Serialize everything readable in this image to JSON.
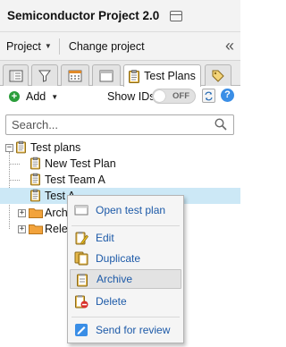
{
  "window": {
    "title": "Semiconductor Project 2.0"
  },
  "project_bar": {
    "project_label": "Project",
    "change_project_label": "Change project",
    "collapse_glyph": "«"
  },
  "tabs": [
    {
      "icon": "document-list-icon",
      "label": ""
    },
    {
      "icon": "filter-icon",
      "label": ""
    },
    {
      "icon": "calendar-icon",
      "label": ""
    },
    {
      "icon": "window-icon",
      "label": ""
    },
    {
      "icon": "clipboard-icon",
      "label": "Test Plans",
      "active": true
    },
    {
      "icon": "tag-icon",
      "label": ""
    }
  ],
  "toolbar": {
    "add_label": "Add",
    "show_ids_label": "Show IDs",
    "toggle_state": "OFF",
    "help_glyph": "?"
  },
  "search": {
    "placeholder": "Search...",
    "value": ""
  },
  "tree": {
    "root_label": "Test plans",
    "items": [
      {
        "label": "New Test Plan",
        "type": "plan"
      },
      {
        "label": "Test Team A",
        "type": "plan"
      },
      {
        "label": "Test A",
        "type": "plan",
        "selected": true
      },
      {
        "label": "Archi",
        "type": "folder"
      },
      {
        "label": "Relea",
        "type": "folder"
      }
    ]
  },
  "context_menu": {
    "items": [
      {
        "label": "Open test plan",
        "icon": "open-window-icon"
      },
      {
        "label": "Edit",
        "icon": "edit-clipboard-icon"
      },
      {
        "label": "Duplicate",
        "icon": "duplicate-clipboard-icon"
      },
      {
        "label": "Archive",
        "icon": "archive-clipboard-icon",
        "highlighted": true
      },
      {
        "label": "Delete",
        "icon": "delete-clipboard-icon"
      },
      {
        "label": "Send for review",
        "icon": "send-review-icon"
      }
    ]
  },
  "colors": {
    "selection": "#cce8f6",
    "link": "#1d5aa8",
    "add_green": "#2a9d3a",
    "help_blue": "#3a8ee6",
    "folder": "#f2a33c"
  }
}
